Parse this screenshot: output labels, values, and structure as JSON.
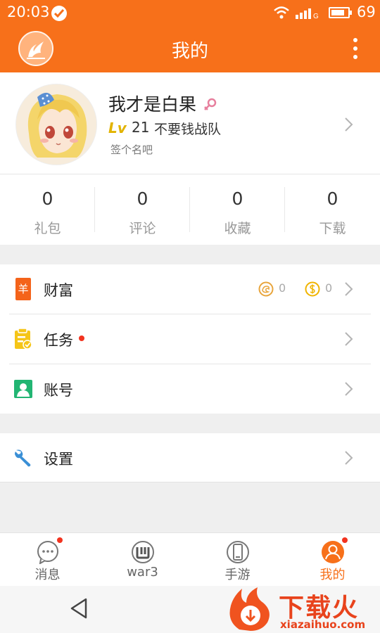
{
  "status_bar": {
    "time": "20:03",
    "battery_level": "69",
    "network_label": "G"
  },
  "app_bar": {
    "title": "我的"
  },
  "profile": {
    "username": "我才是白果",
    "level_badge": "Lv",
    "level": "21",
    "team": "不要钱战队",
    "signature": "签个名吧"
  },
  "stats": [
    {
      "value": "0",
      "label": "礼包"
    },
    {
      "value": "0",
      "label": "评论"
    },
    {
      "value": "0",
      "label": "收藏"
    },
    {
      "value": "0",
      "label": "下载"
    }
  ],
  "menu": {
    "wealth": {
      "label": "财富",
      "icon_glyph": "羊",
      "coin_a_count": "0",
      "coin_b_count": "0"
    },
    "tasks": {
      "label": "任务"
    },
    "account": {
      "label": "账号"
    },
    "settings": {
      "label": "设置"
    }
  },
  "bottom_nav": [
    {
      "label": "消息",
      "icon": "message-icon",
      "badge": true
    },
    {
      "label": "war3",
      "icon": "war3-icon",
      "badge": false
    },
    {
      "label": "手游",
      "icon": "phone-icon",
      "badge": false
    },
    {
      "label": "我的",
      "icon": "profile-icon",
      "badge": true,
      "active": true
    }
  ],
  "watermark": {
    "brand": "下载火",
    "url": "xiazaihuo.com"
  },
  "colors": {
    "accent": "#f7701a",
    "badge": "#f2331f",
    "level": "#e2b300",
    "coin": "#e8a53c",
    "account": "#22b573",
    "settings": "#3a8fd6"
  }
}
